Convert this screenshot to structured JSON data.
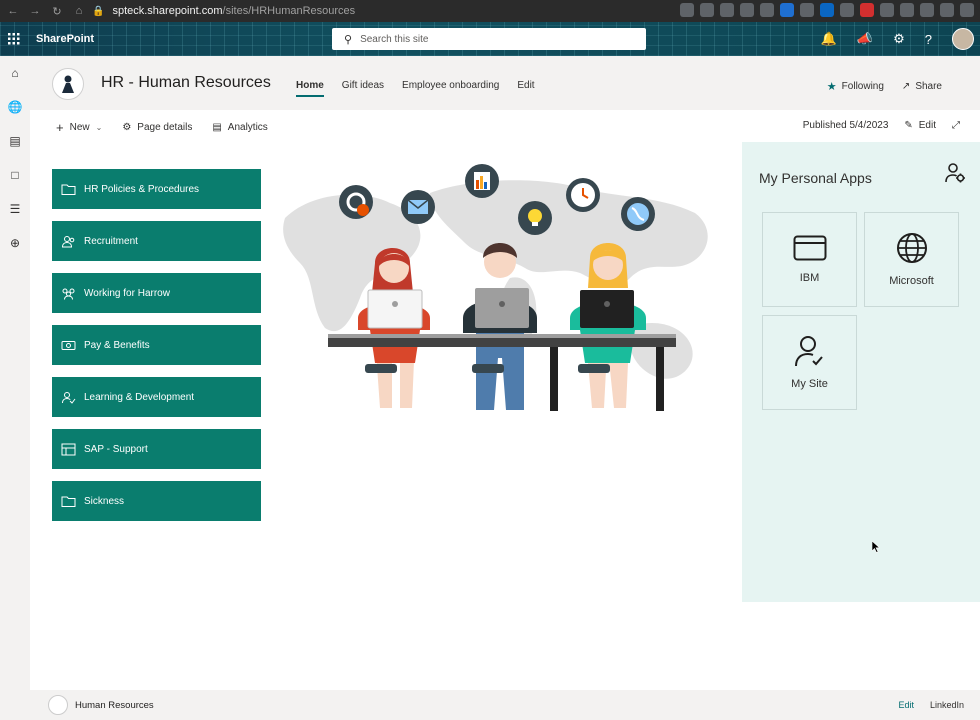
{
  "browser": {
    "url_host": "spteck.sharepoint.com",
    "url_path": "/sites/HRHumanResources"
  },
  "suite": {
    "app_name": "SharePoint",
    "search_placeholder": "Search this site"
  },
  "site": {
    "title": "HR - Human Resources",
    "nav": [
      "Home",
      "Gift ideas",
      "Employee onboarding",
      "Edit"
    ],
    "active_nav": "Home",
    "following_label": "Following",
    "share_label": "Share"
  },
  "command_bar": {
    "new_label": "New",
    "page_details_label": "Page details",
    "analytics_label": "Analytics",
    "published_label": "Published 5/4/2023",
    "edit_label": "Edit"
  },
  "quick_links": [
    {
      "label": "HR Policies & Procedures",
      "icon": "folder-icon"
    },
    {
      "label": "Recruitment",
      "icon": "people-icon"
    },
    {
      "label": "Working for Harrow",
      "icon": "team-icon"
    },
    {
      "label": "Pay & Benefits",
      "icon": "money-icon"
    },
    {
      "label": "Learning & Development",
      "icon": "learning-icon"
    },
    {
      "label": "SAP - Support",
      "icon": "sap-icon"
    },
    {
      "label": "Sickness",
      "icon": "folder-icon"
    }
  ],
  "personal_apps": {
    "title": "My Personal Apps",
    "apps": [
      {
        "label": "IBM",
        "icon": "window-icon"
      },
      {
        "label": "Microsoft",
        "icon": "globe-icon"
      },
      {
        "label": "My Site",
        "icon": "person-check-icon"
      }
    ]
  },
  "footer": {
    "title": "Human Resources",
    "edit_label": "Edit",
    "linkedin_label": "LinkedIn"
  },
  "colors": {
    "theme": "#0a7d6e",
    "accent": "#036c70",
    "panel_bg": "#e6f4f2"
  }
}
